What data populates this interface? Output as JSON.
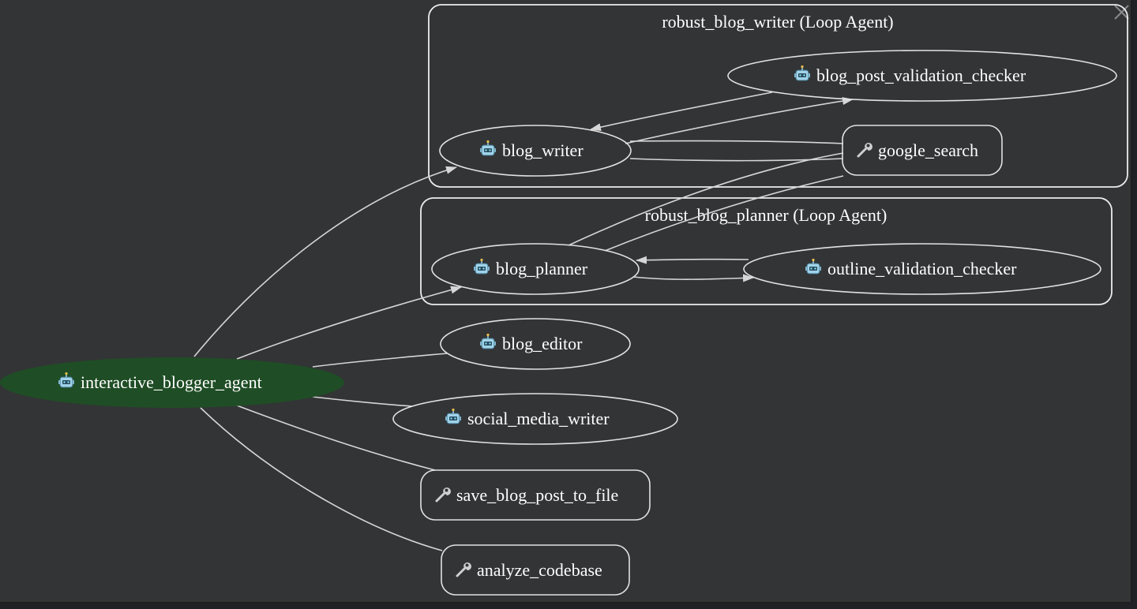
{
  "clusters": {
    "writer": "robust_blog_writer (Loop Agent)",
    "planner": "robust_blog_planner (Loop Agent)"
  },
  "nodes": {
    "root": "interactive_blogger_agent",
    "blog_post_validation_checker": "blog_post_validation_checker",
    "blog_writer": "blog_writer",
    "google_search": "google_search",
    "blog_planner": "blog_planner",
    "outline_validation_checker": "outline_validation_checker",
    "blog_editor": "blog_editor",
    "social_media_writer": "social_media_writer",
    "save_blog_post_to_file": "save_blog_post_to_file",
    "analyze_codebase": "analyze_codebase"
  },
  "icons": {
    "agent": "robot-icon",
    "tool": "wrench-icon",
    "close": "close-icon"
  },
  "colors": {
    "background": "#333436",
    "root_fill": "#1f4d25",
    "line": "#d6d6d6"
  }
}
